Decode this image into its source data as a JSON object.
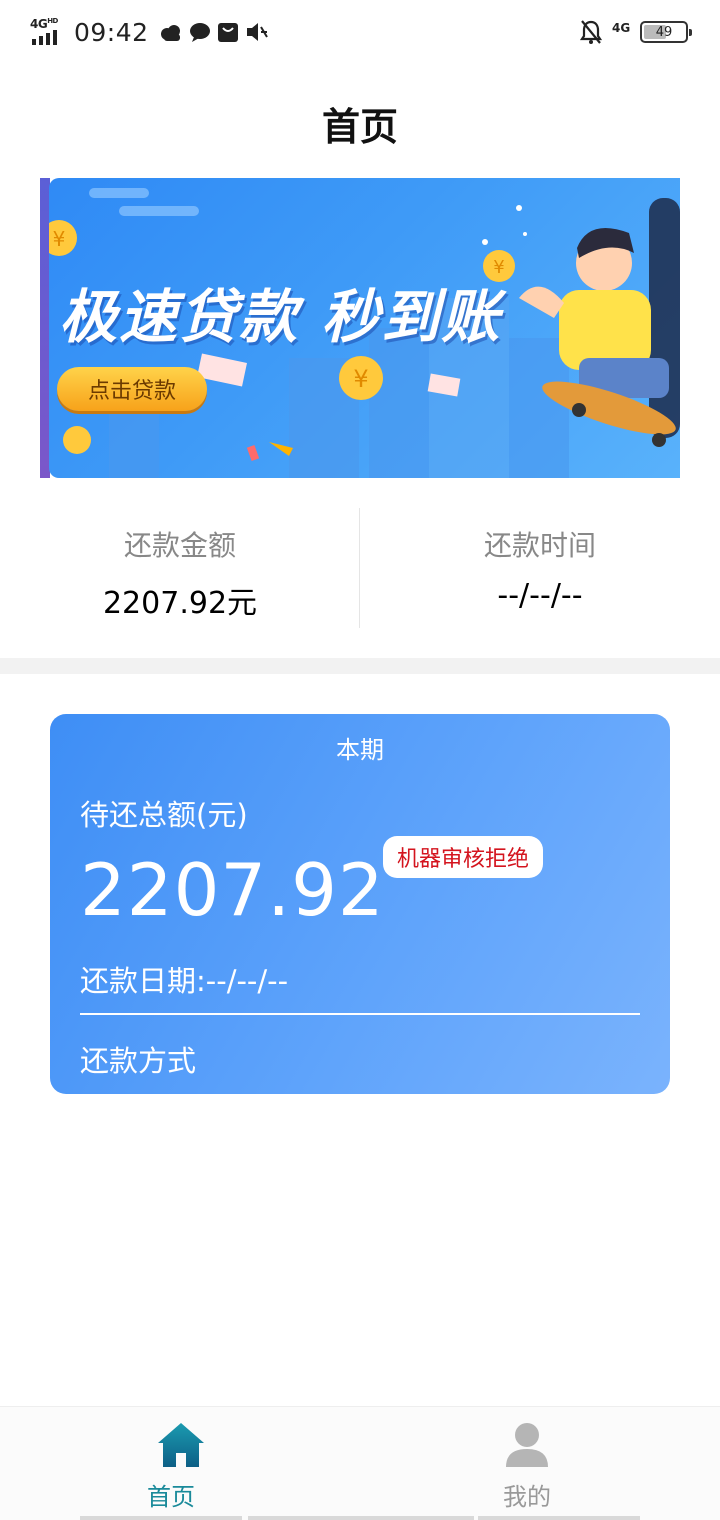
{
  "status_bar": {
    "network_left": "4G",
    "network_hd": "HD",
    "time": "09:42",
    "network_right": "4G",
    "battery": "49"
  },
  "header": {
    "title": "首页"
  },
  "banner": {
    "headline": "极速贷款 秒到账",
    "cta": "点击贷款",
    "colors": {
      "start": "#2f8af5",
      "end": "#59b2fb"
    }
  },
  "summary": {
    "amount_label": "还款金额",
    "amount_value": "2207.92元",
    "time_label": "还款时间",
    "time_value": "--/--/--"
  },
  "period_card": {
    "title": "本期",
    "total_label": "待还总额(元)",
    "total_amount": "2207.92",
    "status_badge": "机器审核拒绝",
    "due_date": "还款日期:--/--/--",
    "method_label": "还款方式",
    "colors": {
      "start": "#3e8ef5",
      "end": "#7ab3fd",
      "badge_text": "#d4141e"
    }
  },
  "tabbar": {
    "items": [
      {
        "label": "首页",
        "icon": "home-icon",
        "active": true
      },
      {
        "label": "我的",
        "icon": "person-icon",
        "active": false
      }
    ],
    "colors": {
      "active": "#1a8a9a",
      "inactive": "#999999"
    }
  }
}
